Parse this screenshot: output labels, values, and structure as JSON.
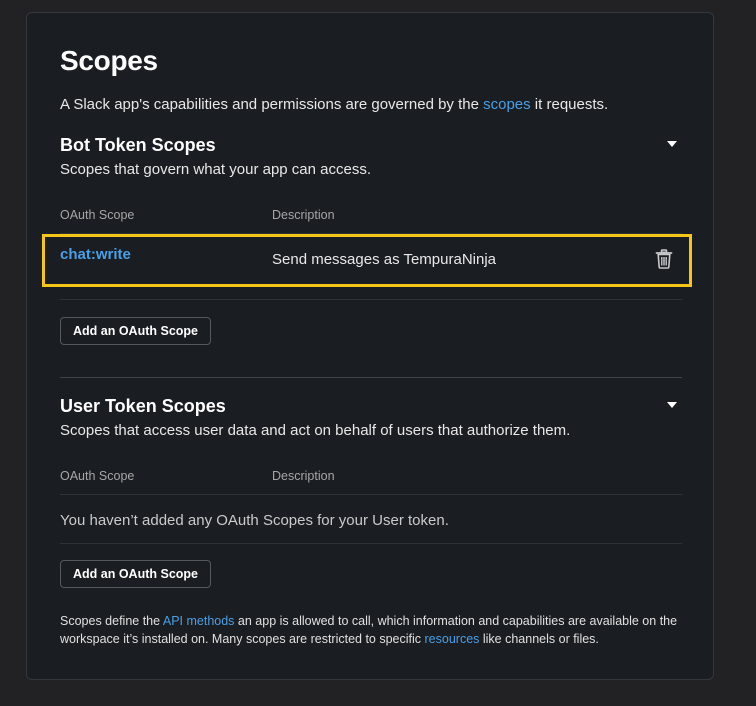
{
  "page": {
    "title": "Scopes",
    "intro_before": "A Slack app's capabilities and permissions are governed by the ",
    "intro_link": "scopes",
    "intro_after": " it requests."
  },
  "bot": {
    "title": "Bot Token Scopes",
    "subtitle": "Scopes that govern what your app can access.",
    "col_scope": "OAuth Scope",
    "col_desc": "Description",
    "rows": [
      {
        "scope": "chat:write",
        "description": "Send messages as TempuraNinja"
      }
    ],
    "add_button": "Add an OAuth Scope"
  },
  "user": {
    "title": "User Token Scopes",
    "subtitle": "Scopes that access user data and act on behalf of users that authorize them.",
    "col_scope": "OAuth Scope",
    "col_desc": "Description",
    "empty_text": "You haven’t added any OAuth Scopes for your User token.",
    "add_button": "Add an OAuth Scope"
  },
  "footer": {
    "part1": "Scopes define the ",
    "link1": "API methods",
    "part2": " an app is allowed to call, which information and capabilities are available on the workspace it’s installed on. Many scopes are restricted to specific ",
    "link2": "resources",
    "part3": " like channels or files."
  },
  "colors": {
    "background": "#222224",
    "card": "#1a1d21",
    "link": "#4a9fe6",
    "highlight": "#f5c518"
  },
  "icons": {
    "section_toggle": "caret-down-icon",
    "delete": "trash-icon"
  }
}
